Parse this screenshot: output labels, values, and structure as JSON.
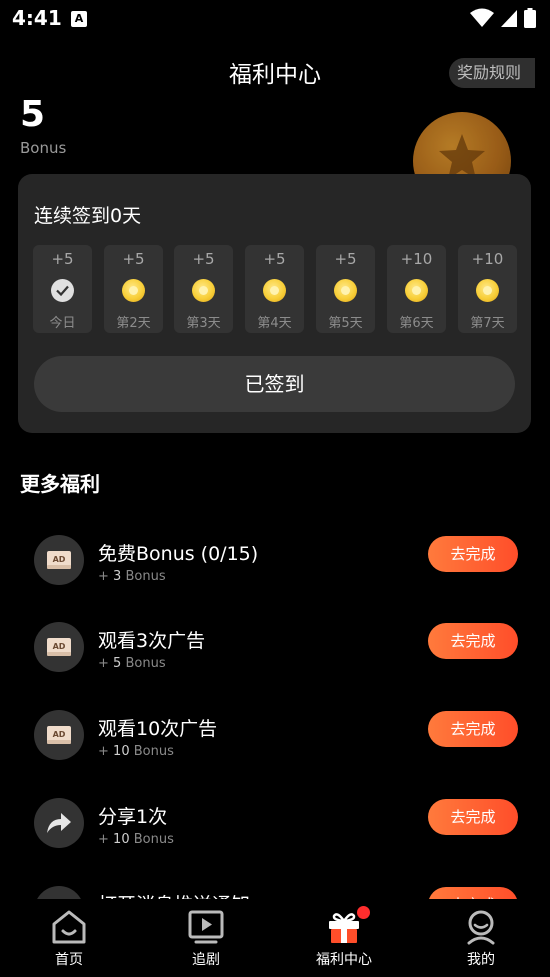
{
  "status_bar": {
    "time": "4:41",
    "notif_letter": "A"
  },
  "header": {
    "title": "福利中心",
    "rules_label": "奖励规则"
  },
  "balance": {
    "value": "5",
    "label": "Bonus"
  },
  "checkin": {
    "title": "连续签到0天",
    "days": [
      {
        "reward": "+5",
        "label": "今日",
        "state": "checked"
      },
      {
        "reward": "+5",
        "label": "第2天",
        "state": "coin"
      },
      {
        "reward": "+5",
        "label": "第3天",
        "state": "coin"
      },
      {
        "reward": "+5",
        "label": "第4天",
        "state": "coin"
      },
      {
        "reward": "+5",
        "label": "第5天",
        "state": "coin"
      },
      {
        "reward": "+10",
        "label": "第6天",
        "state": "coin"
      },
      {
        "reward": "+10",
        "label": "第7天",
        "state": "coin"
      }
    ],
    "button_label": "已签到"
  },
  "more": {
    "title": "更多福利",
    "tasks": [
      {
        "icon": "ad-icon",
        "title": "免费Bonus (0/15)",
        "plus": "+",
        "amount": "3",
        "unit": "Bonus",
        "button": "去完成"
      },
      {
        "icon": "ad-icon",
        "title": "观看3次广告",
        "plus": "+",
        "amount": "5",
        "unit": "Bonus",
        "button": "去完成"
      },
      {
        "icon": "ad-icon",
        "title": "观看10次广告",
        "plus": "+",
        "amount": "10",
        "unit": "Bonus",
        "button": "去完成"
      },
      {
        "icon": "share-icon",
        "title": "分享1次",
        "plus": "+",
        "amount": "10",
        "unit": "Bonus",
        "button": "去完成"
      },
      {
        "icon": "bell-icon",
        "title": "打开消息推送通知",
        "plus": "",
        "amount": "",
        "unit": "",
        "button": "去完成"
      }
    ]
  },
  "nav": {
    "items": [
      {
        "label": "首页",
        "icon": "home-icon"
      },
      {
        "label": "追剧",
        "icon": "play-icon"
      },
      {
        "label": "福利中心",
        "icon": "gift-icon"
      },
      {
        "label": "我的",
        "icon": "profile-icon"
      }
    ]
  },
  "colors": {
    "accent": "#ff5a2e",
    "card": "#262626",
    "badge": "#ff2d2d"
  }
}
